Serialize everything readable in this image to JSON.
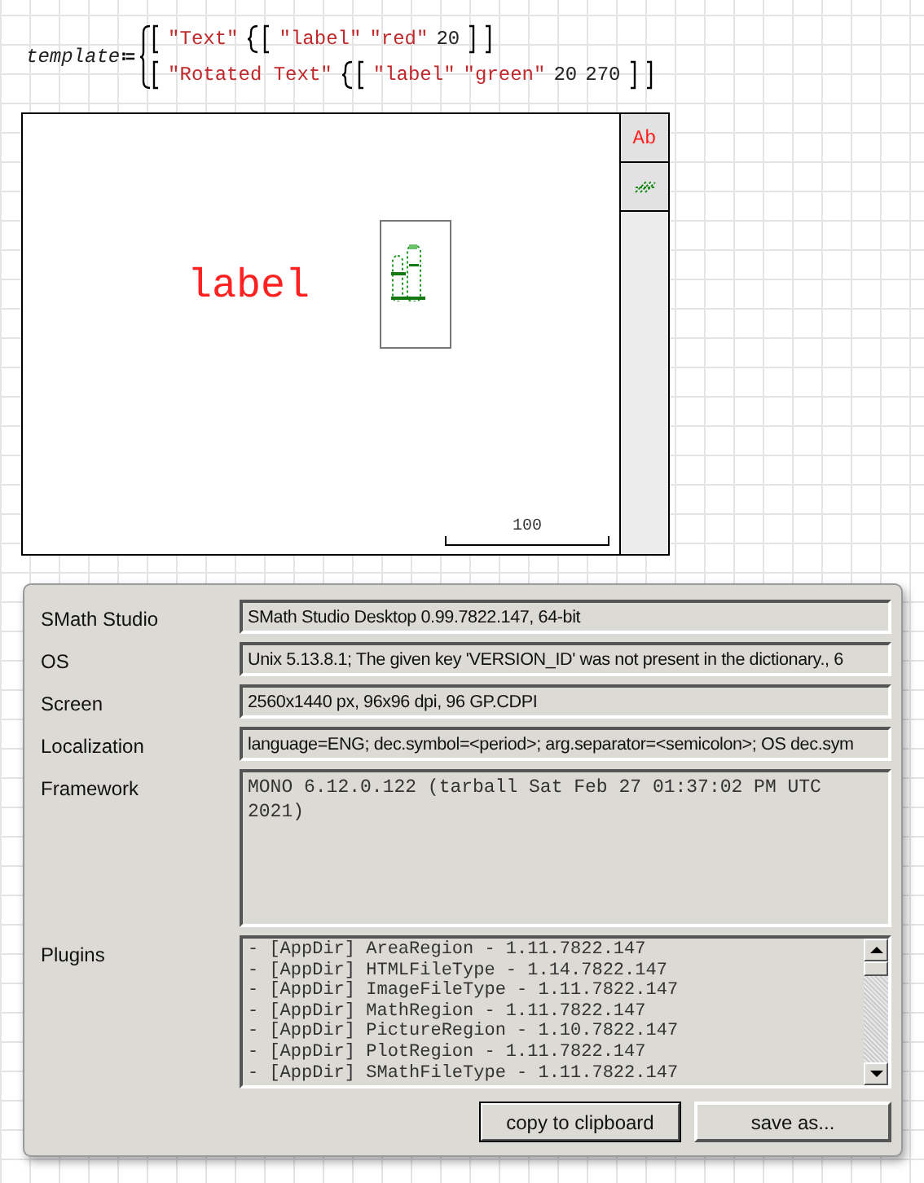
{
  "expression": {
    "name": "template",
    "operator": "≔",
    "rows": [
      {
        "items": [
          {
            "kind": "string",
            "text": "\"Text\""
          },
          {
            "kind": "vector",
            "items": [
              {
                "kind": "string",
                "text": "\"label\""
              },
              {
                "kind": "string",
                "text": "\"red\""
              },
              {
                "kind": "number",
                "text": "20"
              }
            ]
          }
        ]
      },
      {
        "items": [
          {
            "kind": "string",
            "text": "\"Rotated Text\""
          },
          {
            "kind": "vector",
            "items": [
              {
                "kind": "string",
                "text": "\"label\""
              },
              {
                "kind": "string",
                "text": "\"green\""
              },
              {
                "kind": "number",
                "text": "20"
              },
              {
                "kind": "number",
                "text": "270"
              }
            ]
          }
        ]
      }
    ]
  },
  "plot": {
    "text_label": "label",
    "scale_label": "100",
    "tools": [
      {
        "kind": "text",
        "text": "Ab",
        "color": "#ff2020"
      },
      {
        "kind": "rotated",
        "color": "#1a8a1a"
      }
    ]
  },
  "dialog": {
    "rows": [
      {
        "label": "SMath Studio",
        "kind": "line",
        "value": "SMath Studio Desktop 0.99.7822.147, 64-bit"
      },
      {
        "label": "OS",
        "kind": "line",
        "value": "Unix 5.13.8.1; The given key 'VERSION_ID' was not present in the dictionary., 6"
      },
      {
        "label": "Screen",
        "kind": "line",
        "value": "2560x1440 px, 96x96 dpi, 96 GP.CDPI"
      },
      {
        "label": "Localization",
        "kind": "line",
        "value": "language=ENG; dec.symbol=<period>; arg.separator=<semicolon>; OS dec.sym"
      },
      {
        "label": "Framework",
        "kind": "memo",
        "value": "MONO 6.12.0.122 (tarball Sat Feb 27 01:37:02 PM UTC 2021)"
      },
      {
        "label": "Plugins",
        "kind": "list",
        "lines": [
          "- [AppDir] AreaRegion - 1.11.7822.147",
          "- [AppDir] HTMLFileType - 1.14.7822.147",
          "- [AppDir] ImageFileType - 1.11.7822.147",
          "- [AppDir] MathRegion - 1.11.7822.147",
          "- [AppDir] PictureRegion - 1.10.7822.147",
          "- [AppDir] PlotRegion - 1.11.7822.147",
          "- [AppDir] SMathFileType - 1.11.7822.147"
        ]
      }
    ],
    "buttons": [
      {
        "label": "copy to clipboard",
        "selected": true
      },
      {
        "label": "save as...",
        "selected": false
      }
    ]
  }
}
